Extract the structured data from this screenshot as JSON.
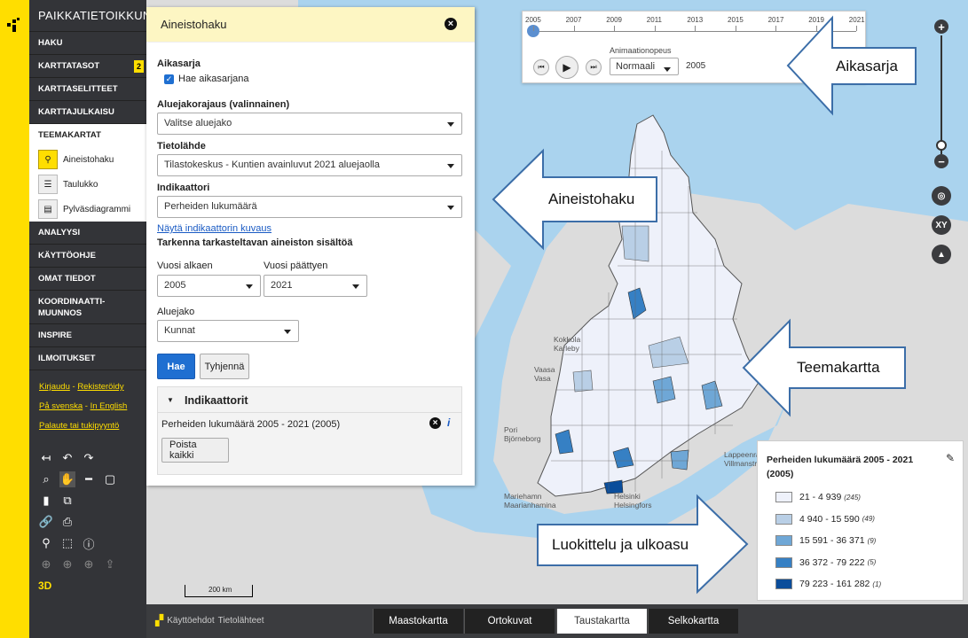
{
  "nav": {
    "brand": "PAIKKATIETOIKKUNA",
    "items": [
      {
        "label": "HAKU"
      },
      {
        "label": "KARTTATASOT",
        "badge": "2"
      },
      {
        "label": "KARTTASELITTEET"
      },
      {
        "label": "KARTTAJULKAISU"
      }
    ],
    "teema_label": "TEEMAKARTAT",
    "tools": [
      {
        "label": "Aineistohaku",
        "icon": "search-icon"
      },
      {
        "label": "Taulukko",
        "icon": "table-icon"
      },
      {
        "label": "Pylväsdiagrammi",
        "icon": "bar-chart-icon"
      }
    ],
    "items2": [
      {
        "label": "ANALYYSI"
      },
      {
        "label": "KÄYTTÖOHJE"
      },
      {
        "label": "OMAT TIEDOT"
      },
      {
        "label": "KOORDINAATTI-MUUNNOS"
      },
      {
        "label": "INSPIRE"
      },
      {
        "label": "ILMOITUKSET"
      }
    ],
    "login": "Kirjaudu",
    "register": "Rekisteröidy",
    "sep": "-",
    "svenska": "På svenska",
    "english": "In English",
    "feedback": "Palaute tai tukipyyntö",
    "three_d": "3D"
  },
  "panel": {
    "title": "Aineistohaku",
    "aikasarja_label": "Aikasarja",
    "aikasarja_checkbox": "Hae aikasarjana",
    "aluejako_rajaus_label": "Aluejakorajaus (valinnainen)",
    "aluejako_rajaus_value": "Valitse aluejako",
    "tietolahde_label": "Tietolähde",
    "tietolahde_value": "Tilastokeskus - Kuntien avainluvut 2021 aluejaolla",
    "indikaattori_label": "Indikaattori",
    "indikaattori_value": "Perheiden lukumäärä",
    "kuvaus_link": "Näytä indikaattorin kuvaus",
    "tarkenna": "Tarkenna tarkasteltavan aineiston sisältöä",
    "vuosi_alkaen_label": "Vuosi alkaen",
    "vuosi_alkaen_value": "2005",
    "vuosi_paattyen_label": "Vuosi päättyen",
    "vuosi_paattyen_value": "2021",
    "aluejako_label": "Aluejako",
    "aluejako_value": "Kunnat",
    "hae": "Hae",
    "tyhjenna": "Tyhjennä",
    "indikaattorit_title": "Indikaattorit",
    "indikaattori_item": "Perheiden lukumäärä 2005 - 2021 (2005)",
    "poista": "Poista kaikki"
  },
  "timeline": {
    "years": [
      "2005",
      "2007",
      "2009",
      "2011",
      "2013",
      "2015",
      "2017",
      "2019",
      "2021"
    ],
    "speed_label": "Animaationopeus",
    "speed_value": "Normaali",
    "current_year": "2005"
  },
  "legend": {
    "title": "Perheiden lukumäärä 2005 - 2021 (2005)",
    "classes": [
      {
        "range": "21 - 4 939",
        "count": "(245)",
        "color": "#eef1fa"
      },
      {
        "range": "4 940 - 15 590",
        "count": "(49)",
        "color": "#b9cfe6"
      },
      {
        "range": "15 591 - 36 371",
        "count": "(9)",
        "color": "#6fa7d6"
      },
      {
        "range": "36 372 - 79 222",
        "count": "(5)",
        "color": "#3680c4"
      },
      {
        "range": "79 223 - 161 282",
        "count": "(1)",
        "color": "#0a4d9b"
      }
    ]
  },
  "map": {
    "places": [
      "Kokkola",
      "Karleby",
      "Vaasa",
      "Vasa",
      "Pori",
      "Björneborg",
      "Mariehamn",
      "Maarianhamina",
      "Helsinki",
      "Helsingfors",
      "Lappeenranta",
      "Villmanstrand"
    ],
    "scale": "200 km"
  },
  "callouts": {
    "aikasarja": "Aikasarja",
    "aineistohaku": "Aineistohaku",
    "teemakartta": "Teemakartta",
    "luokittelu": "Luokittelu ja ulkoasu"
  },
  "bottom": {
    "terms": "Käyttöehdot",
    "sources": "Tietolähteet",
    "tabs": [
      "Maastokartta",
      "Ortokuvat",
      "Taustakartta",
      "Selkokartta"
    ]
  }
}
